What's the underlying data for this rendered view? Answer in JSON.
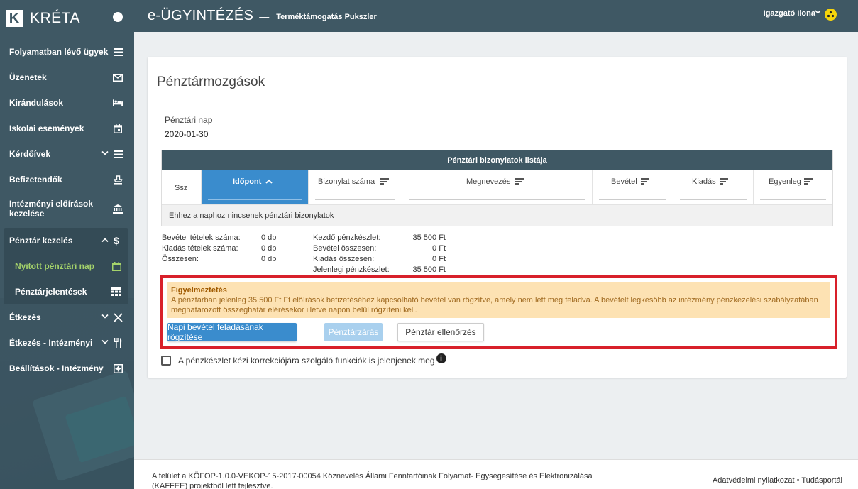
{
  "app": {
    "logo_letter": "K",
    "logo_text": "KRÉTA"
  },
  "header": {
    "title": "e-ÜGYINTÉZÉS",
    "separator": "—",
    "subtitle": "Terméktámogatás Pukszler",
    "user": "Igazgató Ilona"
  },
  "sidebar": {
    "items": [
      {
        "label": "Folyamatban lévő ügyek",
        "icon": "list-icon"
      },
      {
        "label": "Üzenetek",
        "icon": "mail-icon"
      },
      {
        "label": "Kirándulások",
        "icon": "bed-icon"
      },
      {
        "label": "Iskolai események",
        "icon": "calendar-icon"
      },
      {
        "label": "Kérdőívek",
        "icon": "list-icon"
      },
      {
        "label": "Befizetendők",
        "icon": "stamp-icon"
      },
      {
        "label": "Intézményi előírások kezelése",
        "icon": "bank-icon"
      }
    ],
    "group": {
      "label": "Pénztár kezelés",
      "icon": "dollar-icon",
      "subitems": [
        {
          "label": "Nyitott pénztári nap",
          "icon": "calendar-icon",
          "active": true
        },
        {
          "label": "Pénztárjelentések",
          "icon": "table-icon"
        }
      ]
    },
    "items_after": [
      {
        "label": "Étkezés",
        "icon": "cutlery-icon"
      },
      {
        "label": "Étkezés - Intézményi",
        "icon": "fork-icon"
      },
      {
        "label": "Beállítások - Intézmény",
        "icon": "settings-box-icon"
      }
    ]
  },
  "main": {
    "title": "Pénztármozgások",
    "date_label": "Pénztári nap",
    "date_value": "2020-01-30",
    "table": {
      "title": "Pénztári bizonylatok listája",
      "columns": [
        "Ssz",
        "Időpont",
        "Bizonylat száma",
        "Megnevezés",
        "Bevétel",
        "Kiadás",
        "Egyenleg"
      ],
      "empty_message": "Ehhez a naphoz nincsenek pénztári bizonylatok"
    },
    "stats_left": [
      {
        "label": "Bevétel tételek száma:",
        "value": "0 db"
      },
      {
        "label": "Kiadás tételek száma:",
        "value": "0 db"
      },
      {
        "label": "Összesen:",
        "value": "0 db"
      }
    ],
    "stats_right": [
      {
        "label": "Kezdő pénzkészlet:",
        "value": "35 500 Ft"
      },
      {
        "label": "Bevétel összesen:",
        "value": "0 Ft"
      },
      {
        "label": "Kiadás összesen:",
        "value": "0 Ft"
      },
      {
        "label": "Jelenlegi pénzkészlet:",
        "value": "35 500 Ft"
      }
    ],
    "warning": {
      "title": "Figyelmeztetés",
      "text": "A pénztárban jelenleg 35 500 Ft Ft előírások befizetéséhez kapcsolható bevétel van rögzítve, amely nem lett még feladva. A bevételt legkésőbb az intézmény pénzkezelési szabályzatában meghatározott összeghatár elérésekor illetve napon belül rögzíteni kell."
    },
    "buttons": {
      "primary": "Napi bevétel feladásának rögzítése",
      "disabled": "Pénztárzárás",
      "outline": "Pénztár ellenőrzés"
    },
    "checkbox_label": "A pénzkészlet kézi korrekciójára szolgáló funkciók is jelenjenek meg",
    "info_glyph": "i"
  },
  "footer": {
    "text": "A felület a KÖFOP-1.0.0-VEKOP-15-2017-00054 Köznevelés Állami Fenntartóinak Folyamat- Egységesítése és Elektronizálása (KAFFEE) projektből lett fejlesztve.",
    "link1": "Adatvédelmi nyilatkozat",
    "link_sep": "•",
    "link2": "Tudásportál"
  },
  "colors": {
    "sidebar": "#3f5864",
    "accent": "#3a8ccd",
    "active_sub": "#a5d36b",
    "warning_bg": "#fde2b3",
    "warning_frame": "#d8202a"
  }
}
